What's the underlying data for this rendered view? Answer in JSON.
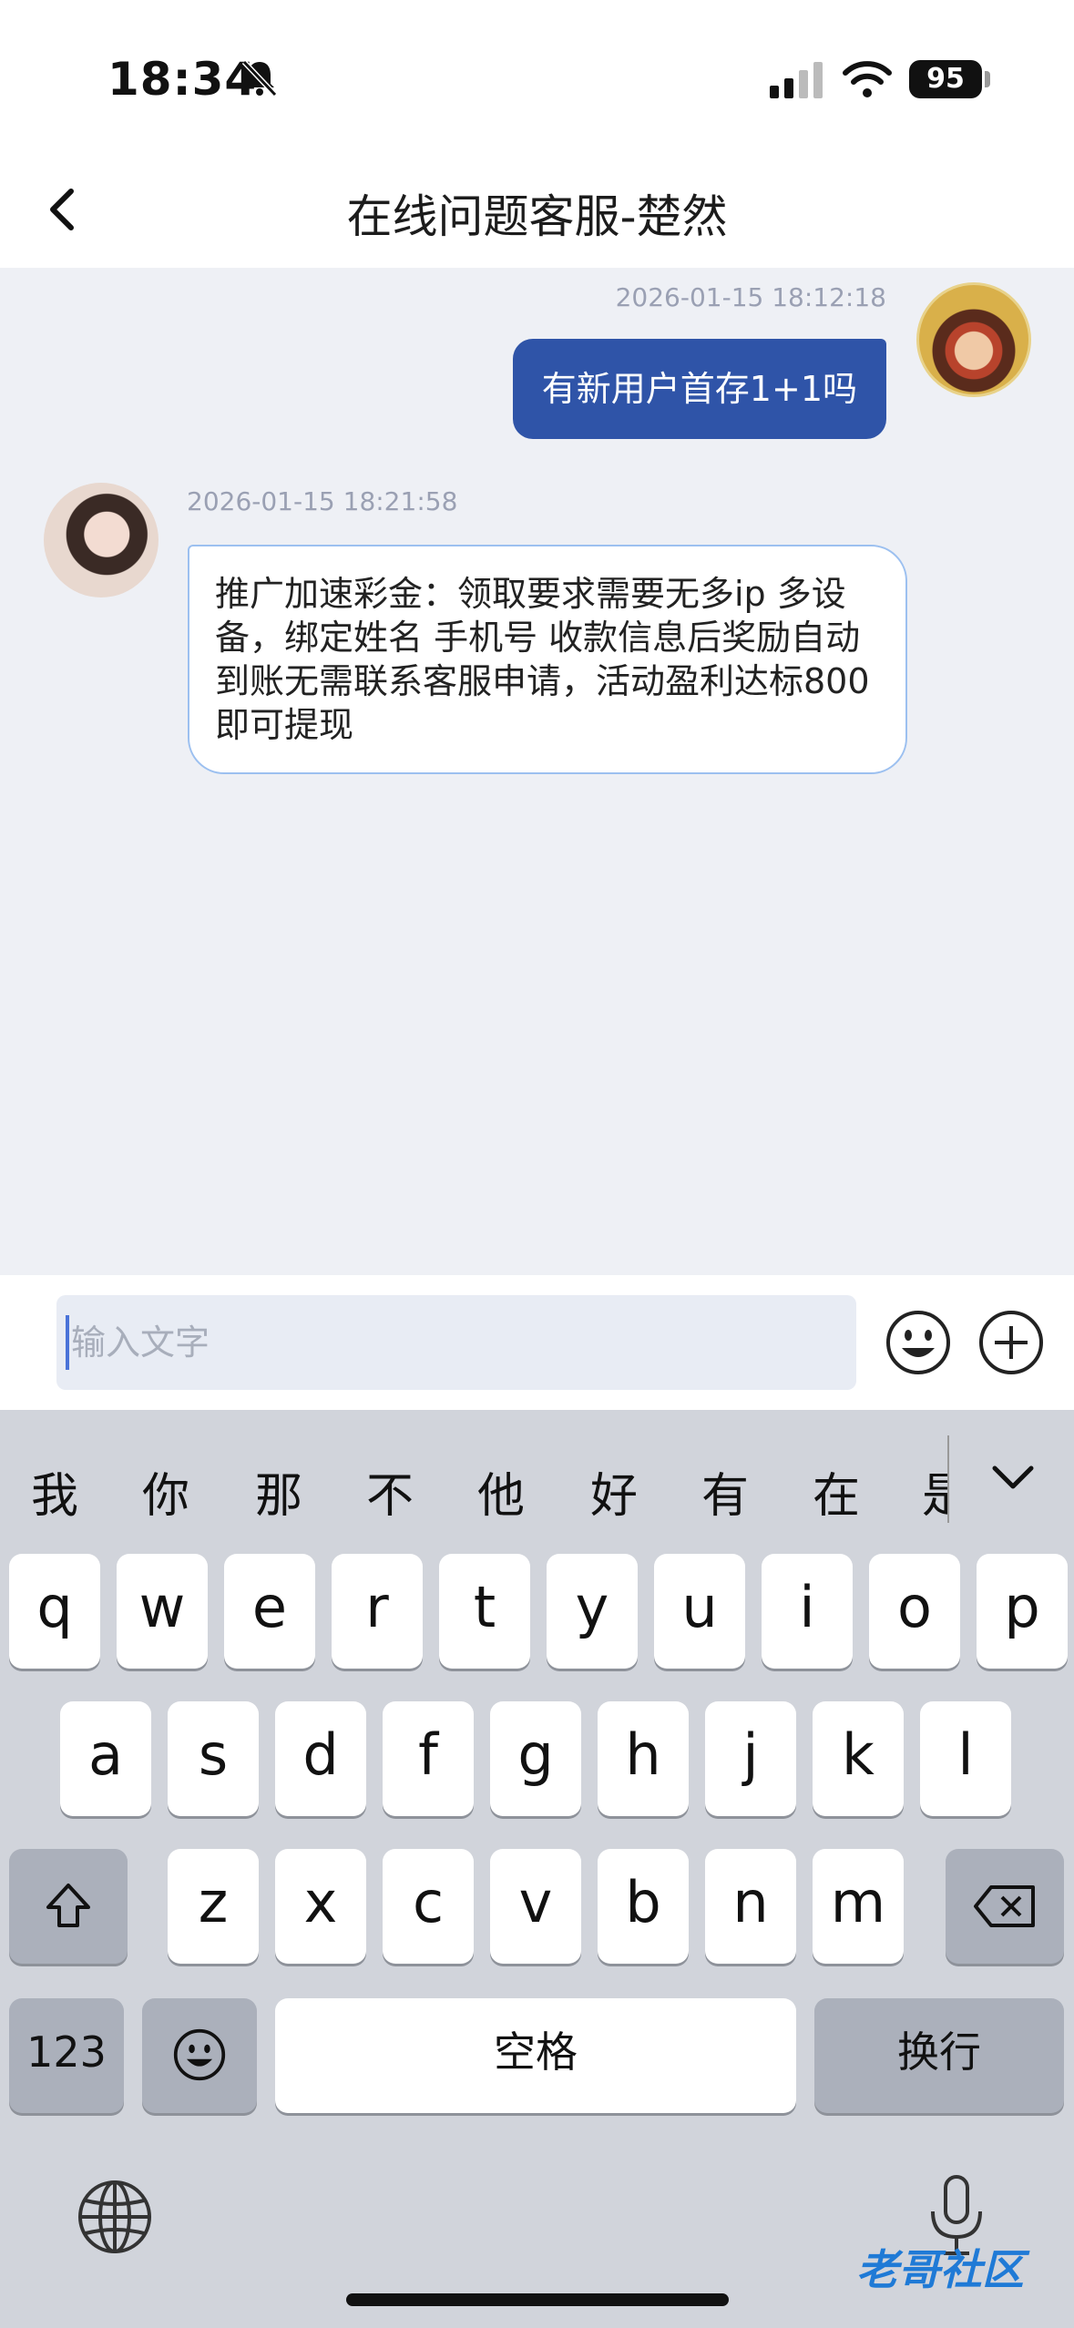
{
  "status_bar": {
    "time": "18:34",
    "battery": "95"
  },
  "nav": {
    "title": "在线问题客服-楚然"
  },
  "messages": [
    {
      "timestamp": "2026-01-15 18:12:18",
      "text": "有新用户首存1+1吗"
    },
    {
      "timestamp": "2026-01-15 18:21:58",
      "text": "推广加速彩金：领取要求需要无多ip 多设备，绑定姓名 手机号 收款信息后奖励自动到账无需联系客服申请，活动盈利达标800即可提现"
    }
  ],
  "input": {
    "placeholder": "输入文字"
  },
  "keyboard": {
    "candidates": [
      "我",
      "你",
      "那",
      "不",
      "他",
      "好",
      "有",
      "在",
      "是"
    ],
    "row1": [
      "q",
      "w",
      "e",
      "r",
      "t",
      "y",
      "u",
      "i",
      "o",
      "p"
    ],
    "row2": [
      "a",
      "s",
      "d",
      "f",
      "g",
      "h",
      "j",
      "k",
      "l"
    ],
    "row3": [
      "z",
      "x",
      "c",
      "v",
      "b",
      "n",
      "m"
    ],
    "numbers_label": "123",
    "space_label": "空格",
    "return_label": "换行"
  },
  "watermark": "老哥社区",
  "colors": {
    "accent": "#2f54a8",
    "chat_bg": "#eef0f5",
    "bubble_border": "#9cc0f0",
    "keyboard_bg": "#d1d4db"
  }
}
